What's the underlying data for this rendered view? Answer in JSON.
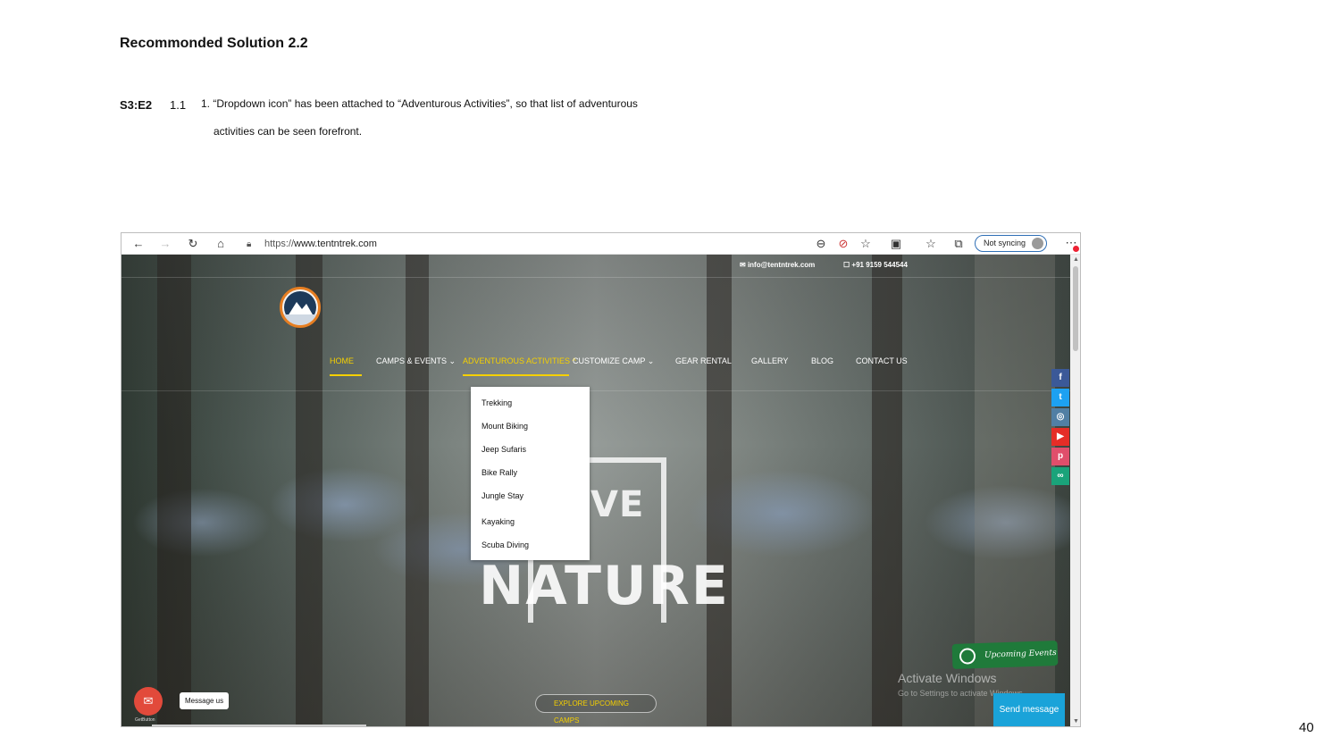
{
  "slide": {
    "title": "Recommonded Solution 2.2",
    "row_id": "S3:E2",
    "row_num": "1.1",
    "text_line1": "1. “Dropdown icon” has been attached to “Adventurous Activities”, so that list of adventurous",
    "text_line2": "activities can be seen forefront.",
    "page_number": "40"
  },
  "browser": {
    "url_proto": "https://",
    "url_host": "www.tentntrek.com",
    "sync_label": "Not syncing",
    "icons": [
      "back-icon",
      "forward-icon",
      "refresh-icon",
      "home-icon",
      "lock-icon",
      "zoom-out-icon",
      "tracking-icon",
      "add-favorite-icon",
      "extensions-icon",
      "favorites-icon",
      "collections-icon",
      "profile-icon",
      "more-icon"
    ]
  },
  "site": {
    "email": "info@tentntrek.com",
    "phone": "+91 9159 544544",
    "nav": [
      {
        "label": "HOME"
      },
      {
        "label": "CAMPS & EVENTS"
      },
      {
        "label": "ADVENTUROUS ACTIVITIES"
      },
      {
        "label": "CUSTOMIZE CAMP"
      },
      {
        "label": "GEAR RENTAL"
      },
      {
        "label": "GALLERY"
      },
      {
        "label": "BLOG"
      },
      {
        "label": "CONTACT US"
      }
    ],
    "dropdown": [
      "Trekking",
      "Mount Biking",
      "Jeep Sufaris",
      "Bike Rally",
      "Jungle Stay",
      "Kayaking",
      "Scuba Diving"
    ],
    "hero_word1": "VE",
    "hero_word2": "NATURE",
    "explore_label": "EXPLORE UPCOMING CAMPS",
    "social": [
      {
        "name": "facebook-icon",
        "glyph": "f",
        "color": "#3b5998"
      },
      {
        "name": "twitter-icon",
        "glyph": "t",
        "color": "#1da1f2"
      },
      {
        "name": "instagram-icon",
        "glyph": "◎",
        "color": "#517fa4"
      },
      {
        "name": "youtube-icon",
        "glyph": "▶",
        "color": "#e52d27"
      },
      {
        "name": "pinterest-icon",
        "glyph": "p",
        "color": "#e04e6b"
      },
      {
        "name": "tripadvisor-icon",
        "glyph": "∞",
        "color": "#1aa37a"
      }
    ],
    "events_label": "Upcoming Events",
    "activate_title": "Activate Windows",
    "activate_sub": "Go to Settings to activate Windows.",
    "send_message": "Send message",
    "message_us": "Message us",
    "getbutton": "GetButton",
    "accent_color": "#f5d000"
  }
}
